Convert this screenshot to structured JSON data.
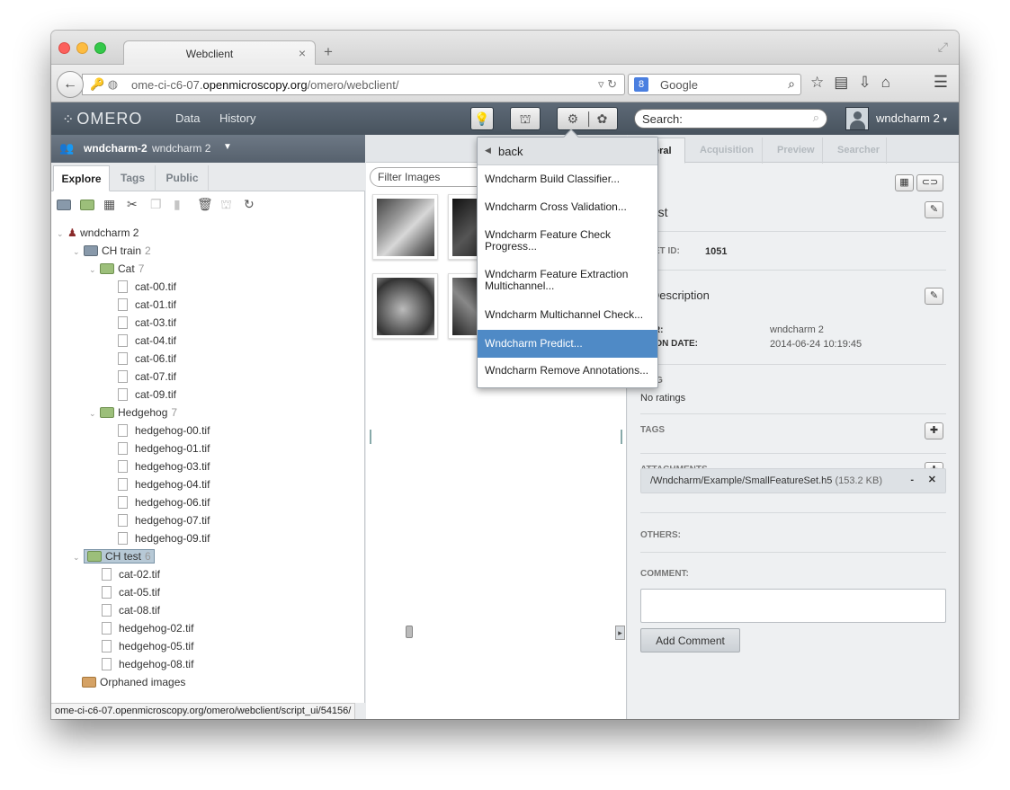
{
  "browser": {
    "tab_title": "Webclient",
    "tab_close": "×",
    "new_tab": "+",
    "url_domain_prefix": "ome-ci-c6-07.",
    "url_domain": "openmicroscopy.org",
    "url_path": "/omero/webclient/",
    "search_engine": "Google",
    "status_url": "ome-ci-c6-07.openmicroscopy.org/omero/webclient/script_ui/54156/"
  },
  "header": {
    "logo": "OMERO",
    "nav": [
      "Data",
      "History"
    ],
    "search_placeholder": "Search:",
    "user": "wndcharm 2"
  },
  "left": {
    "user_bar_strong": "wndcharm-2",
    "user_bar_name": "wndcharm 2",
    "tabs": [
      "Explore",
      "Tags",
      "Public"
    ],
    "tree": {
      "root": "wndcharm 2",
      "ch_train": {
        "label": "CH train",
        "count": "2"
      },
      "cat": {
        "label": "Cat",
        "count": "7"
      },
      "cat_files": [
        "cat-00.tif",
        "cat-01.tif",
        "cat-03.tif",
        "cat-04.tif",
        "cat-06.tif",
        "cat-07.tif",
        "cat-09.tif"
      ],
      "hedgehog": {
        "label": "Hedgehog",
        "count": "7"
      },
      "hedgehog_files": [
        "hedgehog-00.tif",
        "hedgehog-01.tif",
        "hedgehog-03.tif",
        "hedgehog-04.tif",
        "hedgehog-06.tif",
        "hedgehog-07.tif",
        "hedgehog-09.tif"
      ],
      "ch_test": {
        "label": "CH test",
        "count": "6"
      },
      "test_files": [
        "cat-02.tif",
        "cat-05.tif",
        "cat-08.tif",
        "hedgehog-02.tif",
        "hedgehog-05.tif",
        "hedgehog-08.tif"
      ],
      "orphaned": "Orphaned images"
    }
  },
  "center": {
    "filter_placeholder": "Filter Images"
  },
  "dropdown": {
    "back": "back",
    "items": [
      "Wndcharm Build Classifier...",
      "Wndcharm Cross Validation...",
      "Wndcharm Feature Check Progress...",
      "Wndcharm Feature Extraction Multichannel...",
      "Wndcharm Multichannel Check...",
      "Wndcharm Predict...",
      "Wndcharm Remove Annotations..."
    ],
    "highlighted_index": 5
  },
  "right": {
    "tabs": [
      "General",
      "Acquisition",
      "Preview",
      "Searcher"
    ],
    "active_tab": "General",
    "tab_visible_text": "eral",
    "dataset_name": "CH test",
    "dataset_name_visible": "l test",
    "dataset_id_label_visible": "ASET ID:",
    "dataset_id": "1051",
    "description_visible": "d Description",
    "owner_label_visible": "ner:",
    "owner": "wndcharm 2",
    "date_label_visible": "ation Date:",
    "creation_date": "2014-06-24 10:19:45",
    "rating_label_visible": "TING",
    "no_ratings": "No ratings",
    "tags_label": "TAGS",
    "attachments_label": "ATTACHMENTS",
    "attachment_file": "/Wndcharm/Example/SmallFeatureSet.h5",
    "attachment_size": "(153.2 KB)",
    "others_label": "OTHERS:",
    "comment_label": "COMMENT:",
    "add_comment": "Add Comment"
  }
}
